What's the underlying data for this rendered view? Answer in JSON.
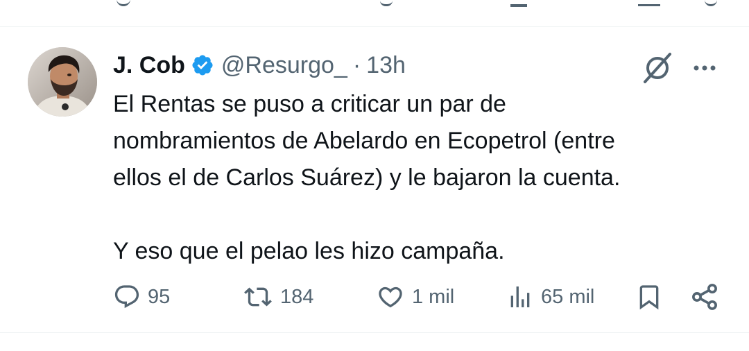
{
  "tweet": {
    "author": {
      "display_name": "J. Cob",
      "handle": "@Resurgo_",
      "verified": true
    },
    "separator": "·",
    "time": "13h",
    "text_lines": [
      "El Rentas se puso a criticar un par de",
      "nombramientos de Abelardo en Ecopetrol (entre",
      "ellos el de Carlos Suárez) y le bajaron la cuenta."
    ],
    "text_paragraph_2": "Y eso que el pelao les hizo campaña.",
    "metrics": {
      "replies": "95",
      "reposts": "184",
      "likes": "1 mil",
      "views": "65 mil"
    }
  },
  "icons": {
    "verified": "verified-badge-icon",
    "grok": "grok-icon",
    "more": "more-horizontal-icon",
    "reply": "reply-icon",
    "repost": "repost-icon",
    "like": "heart-icon",
    "views": "views-chart-icon",
    "bookmark": "bookmark-icon",
    "share": "share-icon"
  },
  "colors": {
    "text_primary": "#0f1419",
    "text_secondary": "#536471",
    "verified_blue": "#1d9bf0",
    "divider": "#eff3f4"
  }
}
